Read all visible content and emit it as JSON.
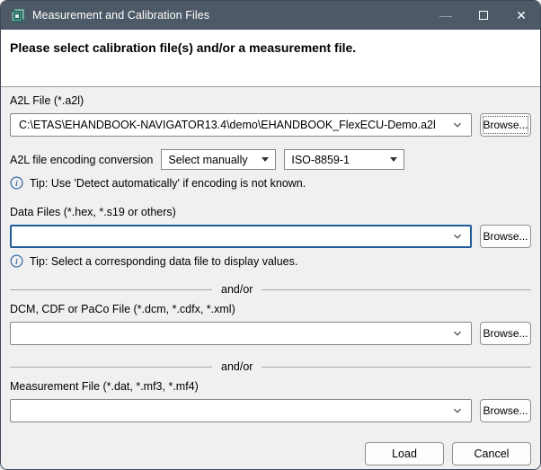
{
  "window": {
    "title": "Measurement and Calibration Files",
    "controls": {
      "minimize": "—",
      "close": "✕"
    }
  },
  "header": {
    "text": "Please select calibration file(s) and/or a measurement file."
  },
  "colors": {
    "titlebar": "#4e5968",
    "content_bg": "#f0f0f0",
    "focus_border": "#1e5c99",
    "info_icon": "#3a6fa5",
    "icon_teal": "#3e8a80"
  },
  "sections": {
    "a2l": {
      "label": "A2L File (*.a2l)",
      "value": "C:\\ETAS\\EHANDBOOK-NAVIGATOR13.4\\demo\\EHANDBOOK_FlexECU-Demo.a2l",
      "browse": "Browse..."
    },
    "encoding": {
      "label": "A2L file encoding conversion",
      "mode": "Select manually",
      "charset": "ISO-8859-1",
      "tip": "Tip: Use 'Detect automatically' if encoding is not known."
    },
    "data_files": {
      "label": "Data Files (*.hex, *.s19 or others)",
      "value": "",
      "browse": "Browse...",
      "tip": "Tip: Select a corresponding data file to display values."
    },
    "separator1": "and/or",
    "dcm": {
      "label": "DCM, CDF or PaCo File (*.dcm, *.cdfx, *.xml)",
      "value": "",
      "browse": "Browse..."
    },
    "separator2": "and/or",
    "measurement": {
      "label": "Measurement File (*.dat, *.mf3, *.mf4)",
      "value": "",
      "browse": "Browse..."
    }
  },
  "footer": {
    "load": "Load",
    "cancel": "Cancel"
  }
}
